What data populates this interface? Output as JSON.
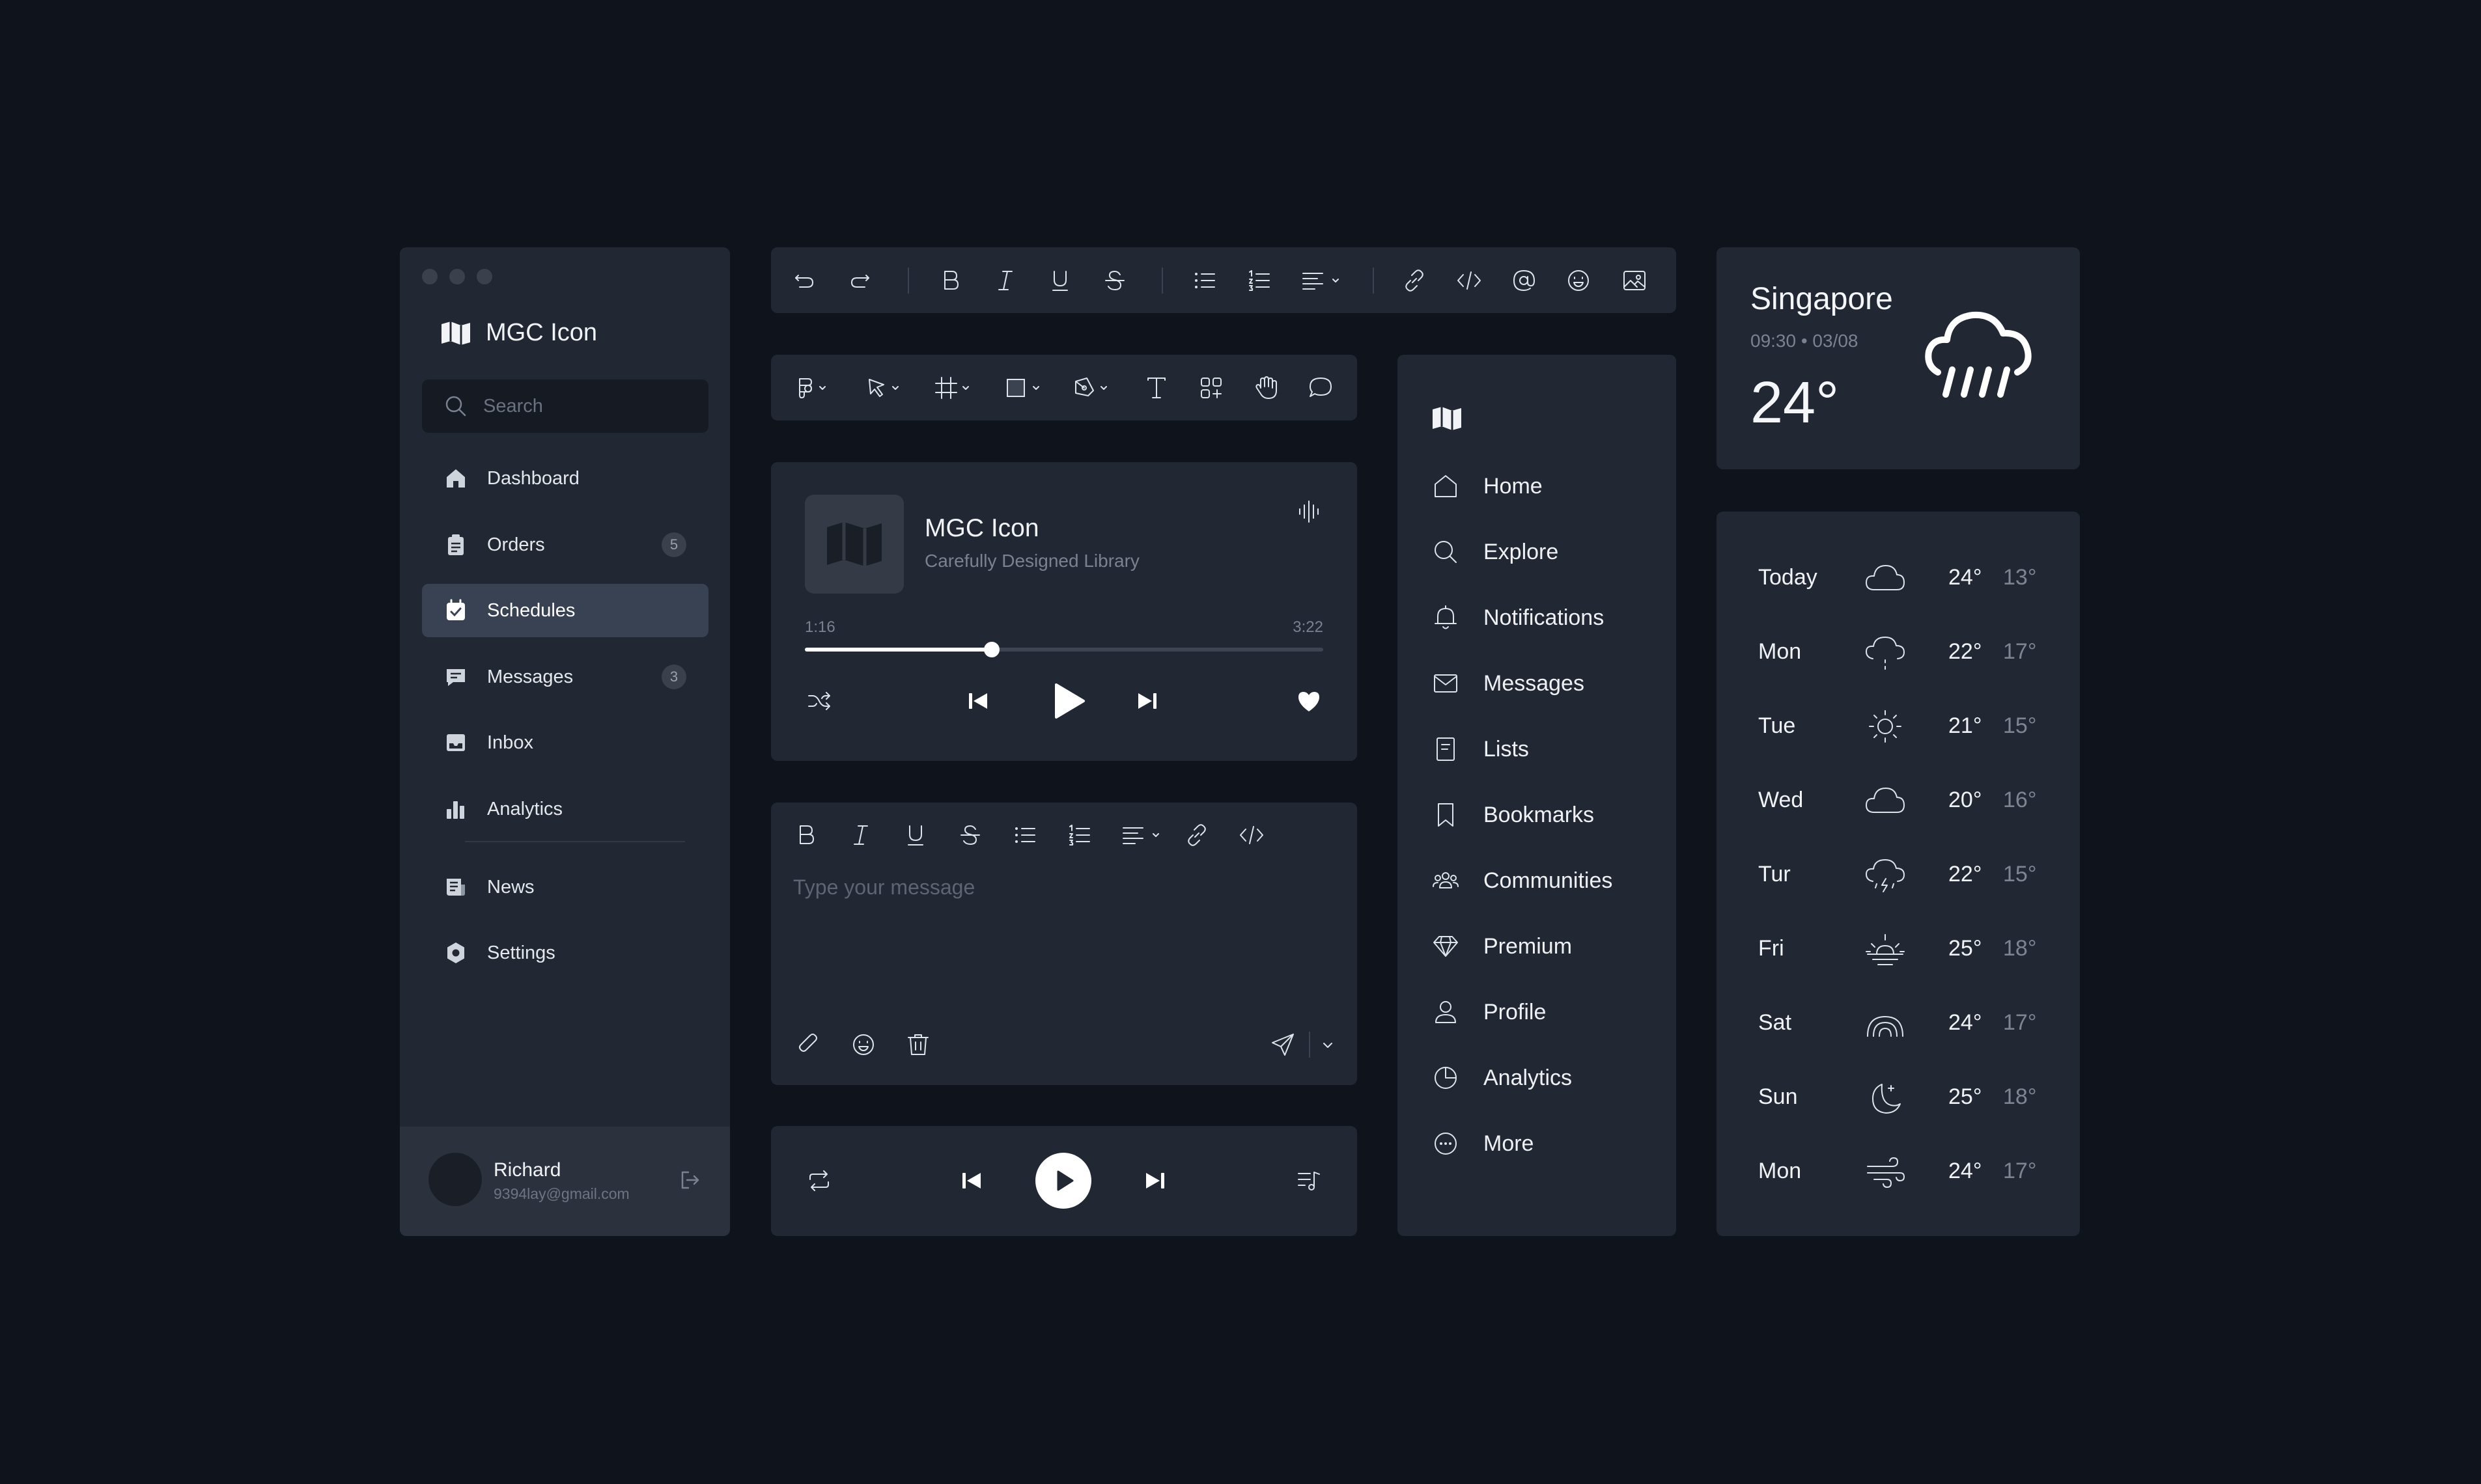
{
  "sidebar": {
    "brand": "MGC Icon",
    "search_placeholder": "Search",
    "items": [
      {
        "label": "Dashboard",
        "icon": "home-icon"
      },
      {
        "label": "Orders",
        "icon": "clipboard-icon",
        "badge": "5"
      },
      {
        "label": "Schedules",
        "icon": "calendar-check-icon",
        "active": true
      },
      {
        "label": "Messages",
        "icon": "chat-icon",
        "badge": "3"
      },
      {
        "label": "Inbox",
        "icon": "inbox-icon"
      },
      {
        "label": "Analytics",
        "icon": "bar-chart-icon"
      },
      {
        "label": "News",
        "icon": "news-icon"
      },
      {
        "label": "Settings",
        "icon": "gear-icon"
      }
    ],
    "user": {
      "name": "Richard",
      "email": "9394lay@gmail.com"
    }
  },
  "player": {
    "title": "MGC Icon",
    "subtitle": "Carefully Designed Library",
    "elapsed": "1:16",
    "duration": "3:22",
    "progress": 0.36
  },
  "editor": {
    "placeholder": "Type your message"
  },
  "menu": {
    "items": [
      {
        "label": "Home",
        "icon": "home-outline-icon"
      },
      {
        "label": "Explore",
        "icon": "search-icon"
      },
      {
        "label": "Notifications",
        "icon": "bell-icon"
      },
      {
        "label": "Messages",
        "icon": "mail-icon"
      },
      {
        "label": "Lists",
        "icon": "list-doc-icon"
      },
      {
        "label": "Bookmarks",
        "icon": "bookmark-icon"
      },
      {
        "label": "Communities",
        "icon": "group-icon"
      },
      {
        "label": "Premium",
        "icon": "diamond-icon"
      },
      {
        "label": "Profile",
        "icon": "user-icon"
      },
      {
        "label": "Analytics",
        "icon": "pie-chart-icon"
      },
      {
        "label": "More",
        "icon": "more-circle-icon"
      }
    ]
  },
  "weather": {
    "city": "Singapore",
    "time": "09:30 • 03/08",
    "temp": "24°",
    "forecast": [
      {
        "day": "Today",
        "hi": "24°",
        "lo": "13°",
        "icon": "cloud-icon"
      },
      {
        "day": "Mon",
        "hi": "22°",
        "lo": "17°",
        "icon": "cloud-drizzle-icon"
      },
      {
        "day": "Tue",
        "hi": "21°",
        "lo": "15°",
        "icon": "sun-icon"
      },
      {
        "day": "Wed",
        "hi": "20°",
        "lo": "16°",
        "icon": "cloud-icon"
      },
      {
        "day": "Tur",
        "hi": "22°",
        "lo": "15°",
        "icon": "thunderstorm-icon"
      },
      {
        "day": "Fri",
        "hi": "25°",
        "lo": "18°",
        "icon": "sunrise-icon"
      },
      {
        "day": "Sat",
        "hi": "24°",
        "lo": "17°",
        "icon": "rainbow-icon"
      },
      {
        "day": "Sun",
        "hi": "25°",
        "lo": "18°",
        "icon": "moon-icon"
      },
      {
        "day": "Mon",
        "hi": "24°",
        "lo": "17°",
        "icon": "wind-icon"
      }
    ]
  },
  "colors": {
    "background": "#0e131c",
    "card": "#222833",
    "active": "#394252",
    "accent": "#ffffff"
  }
}
